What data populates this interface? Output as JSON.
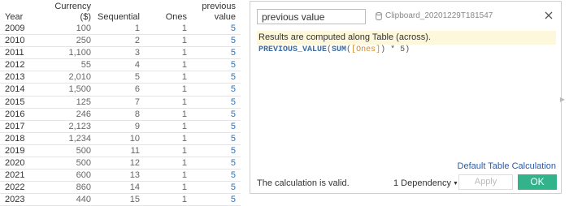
{
  "table": {
    "headers": {
      "year": "Year",
      "currency_l1": "Currency",
      "currency_l2": "($)",
      "sequential": "Sequential",
      "ones": "Ones",
      "previous_l1": "previous",
      "previous_l2": "value"
    },
    "rows": [
      {
        "year": "2009",
        "currency": "100",
        "sequential": "1",
        "ones": "1",
        "previous": "5"
      },
      {
        "year": "2010",
        "currency": "250",
        "sequential": "2",
        "ones": "1",
        "previous": "5"
      },
      {
        "year": "2011",
        "currency": "1,100",
        "sequential": "3",
        "ones": "1",
        "previous": "5"
      },
      {
        "year": "2012",
        "currency": "55",
        "sequential": "4",
        "ones": "1",
        "previous": "5"
      },
      {
        "year": "2013",
        "currency": "2,010",
        "sequential": "5",
        "ones": "1",
        "previous": "5"
      },
      {
        "year": "2014",
        "currency": "1,500",
        "sequential": "6",
        "ones": "1",
        "previous": "5"
      },
      {
        "year": "2015",
        "currency": "125",
        "sequential": "7",
        "ones": "1",
        "previous": "5"
      },
      {
        "year": "2016",
        "currency": "246",
        "sequential": "8",
        "ones": "1",
        "previous": "5"
      },
      {
        "year": "2017",
        "currency": "2,123",
        "sequential": "9",
        "ones": "1",
        "previous": "5"
      },
      {
        "year": "2018",
        "currency": "1,234",
        "sequential": "10",
        "ones": "1",
        "previous": "5"
      },
      {
        "year": "2019",
        "currency": "500",
        "sequential": "11",
        "ones": "1",
        "previous": "5"
      },
      {
        "year": "2020",
        "currency": "500",
        "sequential": "12",
        "ones": "1",
        "previous": "5"
      },
      {
        "year": "2021",
        "currency": "600",
        "sequential": "13",
        "ones": "1",
        "previous": "5"
      },
      {
        "year": "2022",
        "currency": "860",
        "sequential": "14",
        "ones": "1",
        "previous": "5"
      },
      {
        "year": "2023",
        "currency": "440",
        "sequential": "15",
        "ones": "1",
        "previous": "5"
      }
    ]
  },
  "dialog": {
    "calc_name": "previous value",
    "datasource": "Clipboard_20201229T181547",
    "notice": "Results are computed along Table (across).",
    "formula": {
      "fn": "PREVIOUS_VALUE",
      "open1": "(",
      "agg": "SUM",
      "open2": "(",
      "field": "[Ones]",
      "close2": ")",
      "rest": " * 5)"
    },
    "default_link": "Default Table Calculation",
    "status": "The calculation is valid.",
    "dependency": "1 Dependency",
    "apply_label": "Apply",
    "ok_label": "OK",
    "icons": {
      "close": "close-icon",
      "datasource": "database-icon",
      "dependency_caret": "caret-down-icon",
      "scroll": "chevron-right-icon"
    },
    "colors": {
      "ok_button": "#33b38a",
      "link": "#2d5ba6",
      "notice_bg": "#fdf7dc"
    }
  }
}
